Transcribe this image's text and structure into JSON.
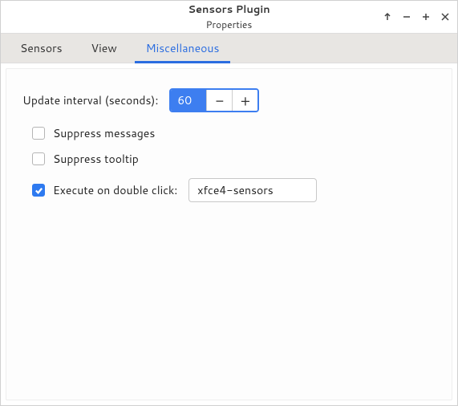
{
  "window": {
    "title": "Sensors Plugin",
    "subtitle": "Properties"
  },
  "tabs": {
    "sensors": "Sensors",
    "view": "View",
    "misc": "Miscellaneous"
  },
  "misc": {
    "update_label": "Update interval (seconds):",
    "update_value": "60",
    "suppress_messages_label": "Suppress messages",
    "suppress_tooltip_label": "Suppress tooltip",
    "execute_label": "Execute on double click:",
    "execute_value": "xfce4-sensors"
  }
}
